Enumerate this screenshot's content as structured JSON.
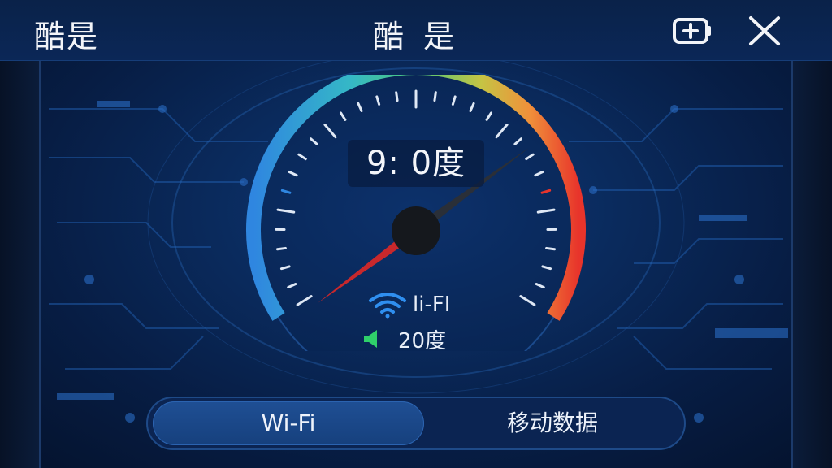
{
  "header": {
    "app_title": "酷是",
    "screen_title": "酷 是",
    "battery_icon": "battery-charging-icon",
    "close_icon": "close-icon"
  },
  "gauge": {
    "readout": "9: 0度",
    "level": 0.72,
    "colors": [
      "#2f86e0",
      "#35c28a",
      "#9ad04a",
      "#f0a43a",
      "#e8342b"
    ]
  },
  "status": {
    "wifi_label": "li-FI",
    "wifi_icon": "wifi-icon",
    "signal_label": "20度",
    "signal_icon": "speaker-icon"
  },
  "tabs": {
    "wifi_label": "Wi-Fi",
    "mobile_label": "移动数据",
    "selected": "Wi-Fi"
  }
}
